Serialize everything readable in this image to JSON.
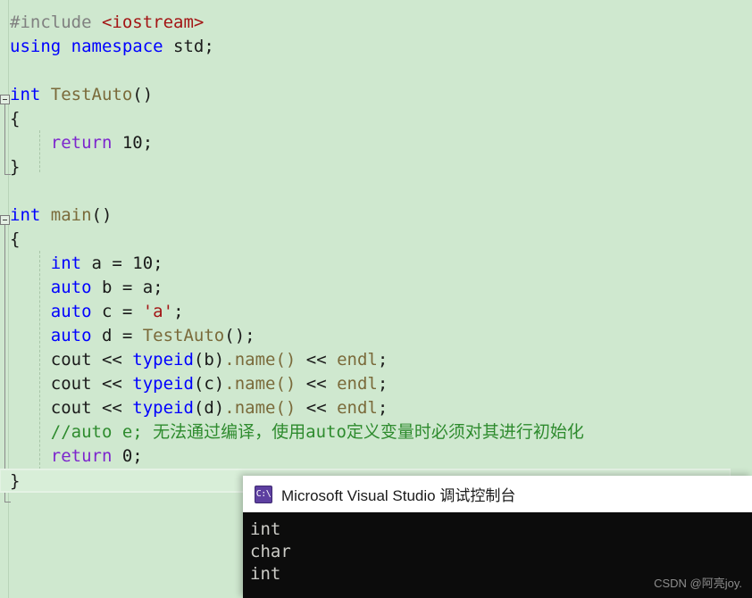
{
  "editor": {
    "language": "cpp",
    "background_color": "#cfe8cf",
    "colors": {
      "preprocessor": "#808080",
      "header": "#a31515",
      "keyword": "#0000ff",
      "control_keyword": "#7d26cd",
      "identifier": "#7a6a3a",
      "string": "#a31515",
      "comment": "#2e8b2e",
      "text": "#1a1a1a"
    },
    "lines": [
      {
        "id": "l1",
        "segments": [
          {
            "t": "#include ",
            "c": "pre"
          },
          {
            "t": "<iostream>",
            "c": "header"
          }
        ]
      },
      {
        "id": "l2",
        "segments": [
          {
            "t": "using namespace ",
            "c": "kw"
          },
          {
            "t": "std",
            "c": "plain"
          },
          {
            "t": ";",
            "c": "punct"
          }
        ]
      },
      {
        "id": "l3",
        "segments": [
          {
            "t": "",
            "c": "plain"
          }
        ]
      },
      {
        "id": "l4",
        "segments": [
          {
            "t": "int ",
            "c": "kw"
          },
          {
            "t": "TestAuto",
            "c": "type"
          },
          {
            "t": "()",
            "c": "punct"
          }
        ]
      },
      {
        "id": "l5",
        "segments": [
          {
            "t": "{",
            "c": "punct"
          }
        ]
      },
      {
        "id": "l6",
        "segments": [
          {
            "t": "    ",
            "c": "plain"
          },
          {
            "t": "return",
            "c": "kw2"
          },
          {
            "t": " 10;",
            "c": "num"
          }
        ]
      },
      {
        "id": "l7",
        "segments": [
          {
            "t": "}",
            "c": "punct"
          }
        ]
      },
      {
        "id": "l8",
        "segments": [
          {
            "t": "",
            "c": "plain"
          }
        ]
      },
      {
        "id": "l9",
        "segments": [
          {
            "t": "int ",
            "c": "kw"
          },
          {
            "t": "main",
            "c": "type"
          },
          {
            "t": "()",
            "c": "punct"
          }
        ]
      },
      {
        "id": "l10",
        "segments": [
          {
            "t": "{",
            "c": "punct"
          }
        ]
      },
      {
        "id": "l11",
        "segments": [
          {
            "t": "    ",
            "c": "plain"
          },
          {
            "t": "int",
            "c": "kw"
          },
          {
            "t": " a = 10;",
            "c": "plain"
          }
        ]
      },
      {
        "id": "l12",
        "segments": [
          {
            "t": "    ",
            "c": "plain"
          },
          {
            "t": "auto",
            "c": "kw"
          },
          {
            "t": " b = a;",
            "c": "plain"
          }
        ]
      },
      {
        "id": "l13",
        "segments": [
          {
            "t": "    ",
            "c": "plain"
          },
          {
            "t": "auto",
            "c": "kw"
          },
          {
            "t": " c = ",
            "c": "plain"
          },
          {
            "t": "'a'",
            "c": "str"
          },
          {
            "t": ";",
            "c": "plain"
          }
        ]
      },
      {
        "id": "l14",
        "segments": [
          {
            "t": "    ",
            "c": "plain"
          },
          {
            "t": "auto",
            "c": "kw"
          },
          {
            "t": " d = ",
            "c": "plain"
          },
          {
            "t": "TestAuto",
            "c": "type"
          },
          {
            "t": "();",
            "c": "plain"
          }
        ]
      },
      {
        "id": "l15",
        "segments": [
          {
            "t": "    cout << ",
            "c": "plain"
          },
          {
            "t": "typeid",
            "c": "kw"
          },
          {
            "t": "(b)",
            "c": "plain"
          },
          {
            "t": ".name()",
            "c": "type"
          },
          {
            "t": " << ",
            "c": "plain"
          },
          {
            "t": "endl",
            "c": "type"
          },
          {
            "t": ";",
            "c": "plain"
          }
        ]
      },
      {
        "id": "l16",
        "segments": [
          {
            "t": "    cout << ",
            "c": "plain"
          },
          {
            "t": "typeid",
            "c": "kw"
          },
          {
            "t": "(c)",
            "c": "plain"
          },
          {
            "t": ".name()",
            "c": "type"
          },
          {
            "t": " << ",
            "c": "plain"
          },
          {
            "t": "endl",
            "c": "type"
          },
          {
            "t": ";",
            "c": "plain"
          }
        ]
      },
      {
        "id": "l17",
        "segments": [
          {
            "t": "    cout << ",
            "c": "plain"
          },
          {
            "t": "typeid",
            "c": "kw"
          },
          {
            "t": "(d)",
            "c": "plain"
          },
          {
            "t": ".name()",
            "c": "type"
          },
          {
            "t": " << ",
            "c": "plain"
          },
          {
            "t": "endl",
            "c": "type"
          },
          {
            "t": ";",
            "c": "plain"
          }
        ]
      },
      {
        "id": "l18",
        "segments": [
          {
            "t": "    //auto e; 无法通过编译，使用auto定义变量时必须对其进行初始化",
            "c": "comment"
          }
        ]
      },
      {
        "id": "l19",
        "segments": [
          {
            "t": "    ",
            "c": "plain"
          },
          {
            "t": "return",
            "c": "kw2"
          },
          {
            "t": " 0;",
            "c": "num"
          }
        ]
      },
      {
        "id": "l20",
        "current": true,
        "segments": [
          {
            "t": "}",
            "c": "punct"
          }
        ]
      }
    ]
  },
  "console": {
    "title": "Microsoft Visual Studio 调试控制台",
    "icon": "console-cmd-icon",
    "icon_label": "C:\\",
    "output": [
      "int",
      "char",
      "int"
    ],
    "background_color": "#0c0c0c",
    "text_color": "#ccccc7"
  },
  "watermark": {
    "text": "CSDN @阿亮joy."
  }
}
